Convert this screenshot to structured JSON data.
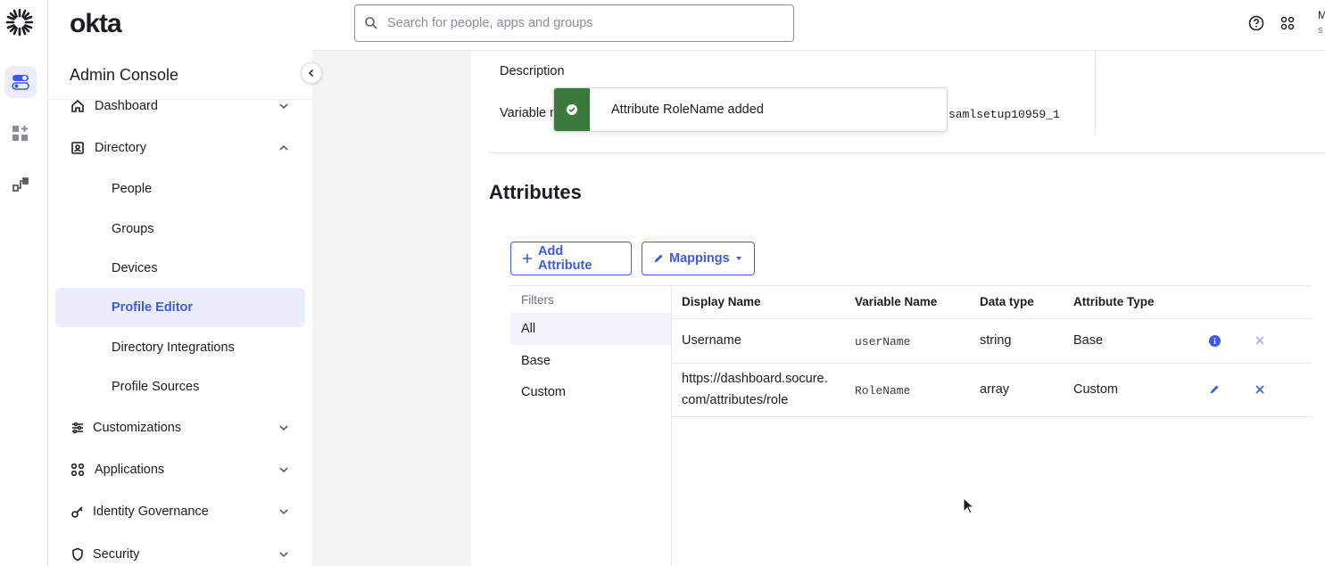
{
  "brand": {
    "name": "okta"
  },
  "sidebar": {
    "title": "Admin Console",
    "items": [
      {
        "label": "Dashboard",
        "icon": "home-icon",
        "expanded": false
      },
      {
        "label": "Directory",
        "icon": "directory-icon",
        "expanded": true
      },
      {
        "label": "Customizations",
        "icon": "sliders-icon",
        "expanded": false
      },
      {
        "label": "Applications",
        "icon": "grid-icon",
        "expanded": false
      },
      {
        "label": "Identity Governance",
        "icon": "key-icon",
        "expanded": false
      },
      {
        "label": "Security",
        "icon": "shield-icon",
        "expanded": false
      }
    ],
    "directory_sub": [
      {
        "label": "People"
      },
      {
        "label": "Groups"
      },
      {
        "label": "Devices"
      },
      {
        "label": "Profile Editor",
        "active": true
      },
      {
        "label": "Directory Integrations"
      },
      {
        "label": "Profile Sources"
      }
    ]
  },
  "topbar": {
    "search_placeholder": "Search for people, apps and groups",
    "user_initial": "M",
    "user_sub": "s"
  },
  "profile": {
    "description_label": "Description",
    "variable_label": "Variable n",
    "variable_value": "samlsetup10959_1"
  },
  "toast": {
    "message": "Attribute RoleName added",
    "status_color": "#3b7a3f"
  },
  "attributes": {
    "title": "Attributes",
    "add_button": "Add Attribute",
    "mappings_button": "Mappings",
    "filters": {
      "header": "Filters",
      "items": [
        "All",
        "Base",
        "Custom"
      ],
      "selected": "All"
    },
    "columns": [
      "Display Name",
      "Variable Name",
      "Data type",
      "Attribute Type"
    ],
    "rows": [
      {
        "display_line1": "Username",
        "display_line2": "",
        "variable": "userName",
        "data_type": "string",
        "attr_type": "Base",
        "action": "info-icon"
      },
      {
        "display_line1": "https://dashboard.socure.",
        "display_line2": "com/attributes/role",
        "variable": "RoleName",
        "data_type": "array",
        "attr_type": "Custom",
        "action": "edit-icon"
      }
    ]
  },
  "colors": {
    "accent": "#3f59e4",
    "success": "#3b7a3f"
  }
}
